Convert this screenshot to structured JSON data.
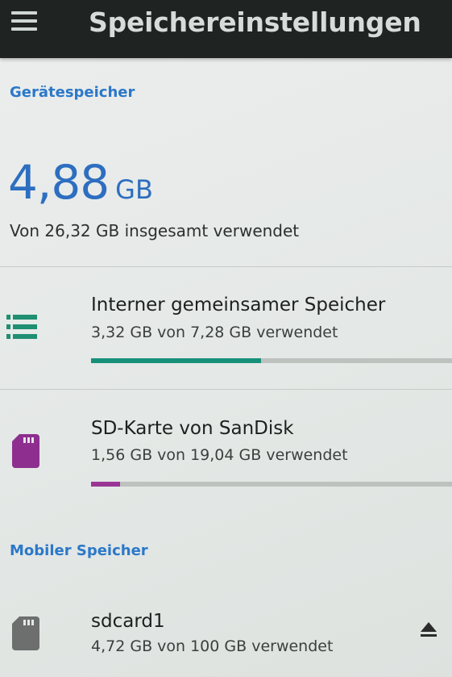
{
  "app_bar": {
    "title": "Speichereinstellungen",
    "menu_icon": "hamburger-menu-icon"
  },
  "device_storage": {
    "header": "Gerätespeicher",
    "used_value": "4,88",
    "used_unit": "GB",
    "total_line": "Von 26,32 GB insgesamt verwendet",
    "volumes": [
      {
        "title": "Interner gemeinsamer Speicher",
        "summary": "3,32 GB von 7,28 GB verwendet",
        "icon": "storage-list-icon",
        "icon_color": "#1f8f72",
        "bar_color": "#17907a",
        "used_fraction": 0.47
      },
      {
        "title": "SD-Karte von SanDisk",
        "summary": "1,56 GB von 19,04 GB verwendet",
        "icon": "sd-card-icon",
        "icon_color": "#8e2f8f",
        "bar_color": "#9a3596",
        "used_fraction": 0.08
      }
    ]
  },
  "portable_storage": {
    "header": "Mobiler Speicher",
    "volumes": [
      {
        "title": "sdcard1",
        "summary": "4,72 GB von 100 GB verwendet",
        "icon": "sd-card-icon",
        "icon_color": "#6d6f6e",
        "action_icon": "eject-icon"
      }
    ]
  },
  "colors": {
    "accent": "#2b78c9",
    "app_bar": "#1f2321"
  }
}
